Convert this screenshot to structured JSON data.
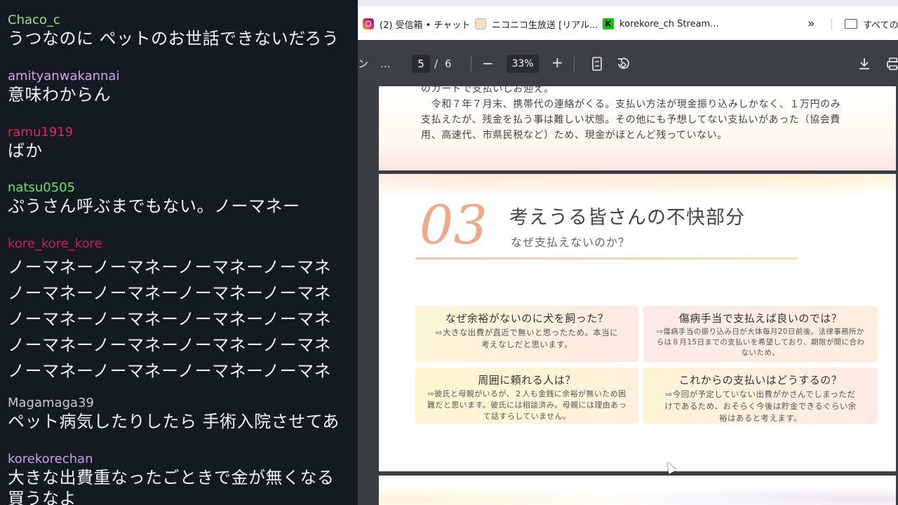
{
  "chat": {
    "messages": [
      {
        "user": "Chaco_c",
        "color": "#9be28f",
        "lines": [
          "うつなのに ペットのお世話できないだろう"
        ]
      },
      {
        "user": "amityanwakannai",
        "color": "#d7a3ee",
        "lines": [
          "意味わからん"
        ]
      },
      {
        "user": "ramu1919",
        "color": "#e0245e",
        "lines": [
          "ばか"
        ]
      },
      {
        "user": "natsu0505",
        "color": "#6be36b",
        "lines": [
          "ぷうさん呼ぶまでもない。ノーマネー"
        ]
      },
      {
        "user": "kore_kore_kore",
        "color": "#c8205a",
        "lines": [
          "ノーマネーノーマネーノーマネーノーマネ",
          "ノーマネーノーマネーノーマネーノーマネ",
          "ノーマネーノーマネーノーマネーノーマネ",
          "ノーマネーノーマネーノーマネーノーマネ",
          "ノーマネーノーマネーノーマネーノーマネ"
        ]
      },
      {
        "user": "Magamaga39",
        "color": "#c9c9c9",
        "lines": [
          "ペット病気したりしたら 手術入院させてあ"
        ]
      },
      {
        "user": "korekorechan",
        "color": "#c8a0ec",
        "lines": [
          "大きな出費重なったごときで金が無くなる",
          "買うなよ"
        ]
      }
    ]
  },
  "browser": {
    "bookmarks": [
      {
        "label": "(2) 受信箱 • チャット",
        "icon": "instagram-icon"
      },
      {
        "label": "ニコニコ生放送 [リアル...",
        "icon": "niconico-icon"
      },
      {
        "label": "korekore_ch Stream...",
        "icon": "kick-icon"
      }
    ],
    "more": "»",
    "all_bookmarks": "すべての",
    "pdf_toolbar": {
      "left_clip": "ン",
      "more": "...",
      "page_current": "5",
      "page_sep": "/",
      "page_total": "6",
      "zoom_out": "−",
      "zoom": "33%",
      "zoom_in": "+"
    }
  },
  "pdf": {
    "top_lines": [
      "のカードで支払いしお迎え。",
      "　令和７年７月末、携帯代の連絡がくる。支払い方法が現金振り込みしかなく、１万円のみ",
      "支払えたが、残金を払う事は難しい状態。その他にも予想してない支払いがあった（協会費",
      "用、高速代、市県民税など）ため、現金がほとんど残っていない。"
    ],
    "section": {
      "number": "03",
      "title": "考えうる皆さんの不快部分",
      "subtitle": "なぜ支払えないのか？"
    },
    "cards": [
      {
        "q": "なぜ余裕がないのに犬を飼った？",
        "a": [
          "⇨大きな出費が直近で無いと思ったため。本当に",
          "考えなしだと思います。"
        ]
      },
      {
        "q": "傷病手当で支払えば良いのでは？",
        "a": [
          "⇨傷病手当の振り込み日が大体毎月20日前後。法律事務所か",
          "らは８月15日までの支払いを希望しており、期限が間に合わ",
          "ないため。"
        ]
      },
      {
        "q": "周囲に頼れる人は？",
        "a": [
          "⇨彼氏と母親がいるが、２人も金銭に余裕が無いため困",
          "難だと思います。彼氏には相談済み。母親には理由あっ",
          "て話すらしていません。"
        ]
      },
      {
        "q": "これからの支払いはどうするの？",
        "a": [
          "⇨今回が予定していない出費がかさんでしまっただ",
          "けであるため、おそらく今後は貯金できるぐらい余",
          "裕はあると考えます。"
        ]
      }
    ]
  }
}
